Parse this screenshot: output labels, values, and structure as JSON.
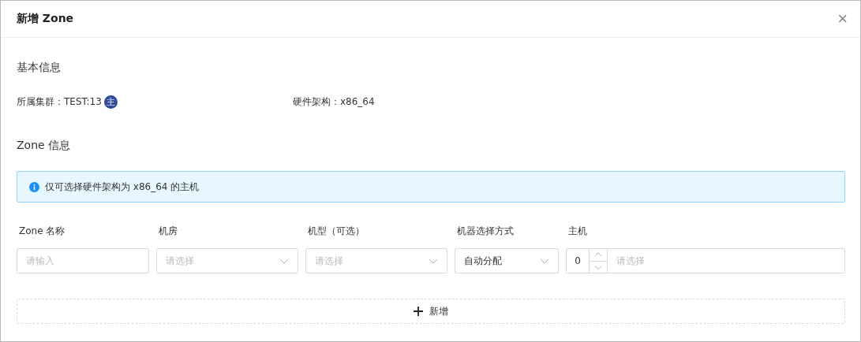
{
  "dialog": {
    "title": "新增 Zone",
    "close": "×"
  },
  "basic_info": {
    "heading": "基本信息",
    "cluster": {
      "label": "所属集群：TEST:13",
      "badge": "主"
    },
    "arch": {
      "label": "硬件架构：x86_64"
    }
  },
  "zone_info": {
    "heading": "Zone 信息",
    "alert": "仅可选择硬件架构为 x86_64 的主机",
    "fields": [
      {
        "kind": "input",
        "label": "Zone 名称",
        "placeholder": "请输入"
      },
      {
        "kind": "select",
        "label": "机房",
        "placeholder": "请选择"
      },
      {
        "kind": "select",
        "label": "机型（可选）",
        "placeholder": "请选择"
      },
      {
        "kind": "select",
        "label": "机器选择方式",
        "value": "自动分配"
      },
      {
        "kind": "host",
        "label": "主机",
        "count": "0",
        "placeholder": "请选择"
      }
    ],
    "add_button": "新增"
  }
}
